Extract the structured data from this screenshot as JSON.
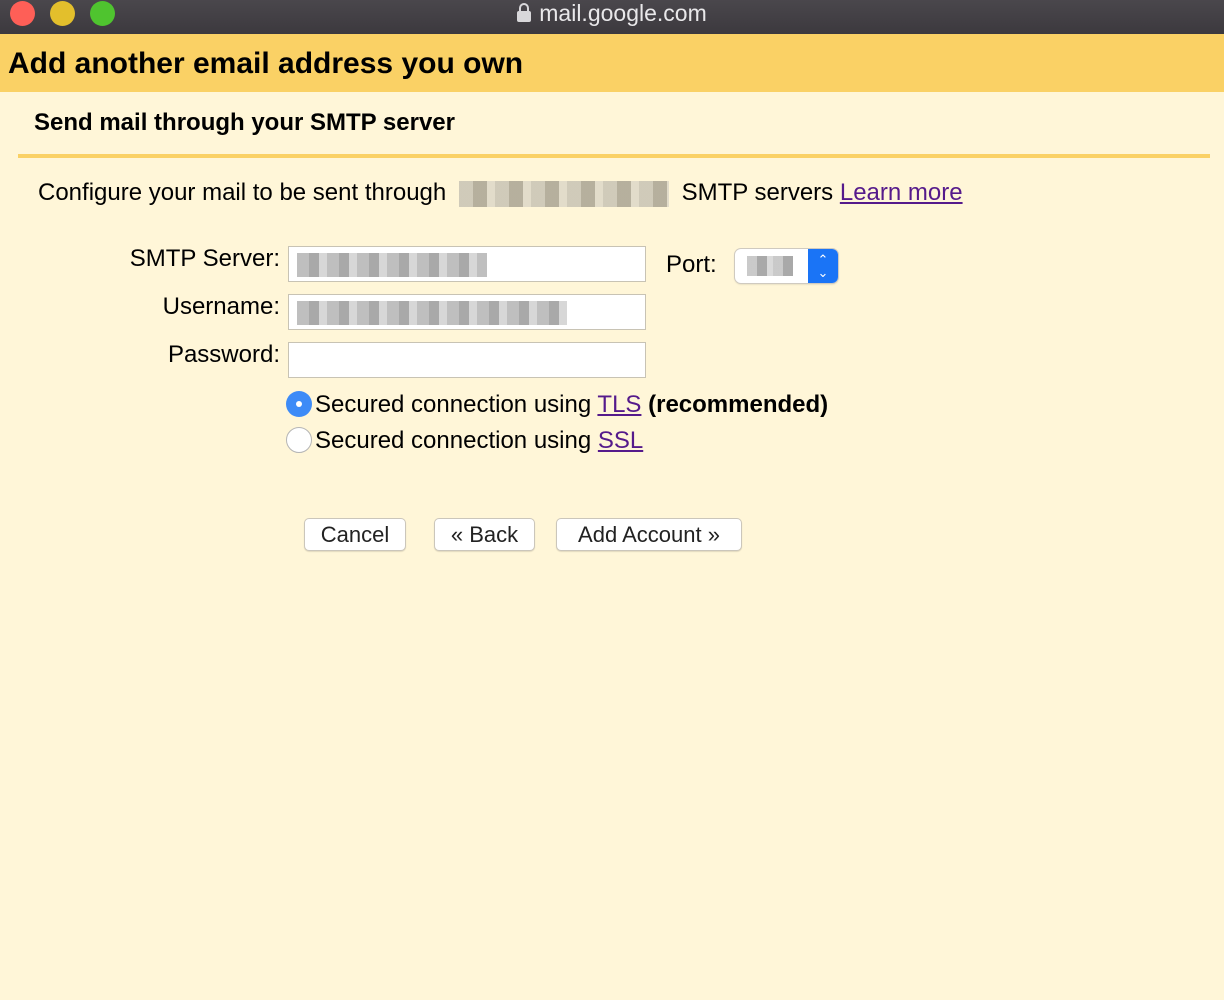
{
  "browser": {
    "url": "mail.google.com",
    "traffic_lights": [
      "close",
      "minimize",
      "maximize"
    ]
  },
  "header": {
    "title": "Add another email address you own"
  },
  "section": {
    "subtitle": "Send mail through your SMTP server"
  },
  "description": {
    "prefix": "Configure your mail to be sent through",
    "suffix": "SMTP servers",
    "learn_more": "Learn more"
  },
  "form": {
    "smtp_server_label": "SMTP Server:",
    "username_label": "Username:",
    "password_label": "Password:",
    "port_label": "Port:",
    "password_value": ""
  },
  "security": {
    "options": [
      {
        "prefix": "Secured connection using",
        "link": "TLS",
        "note": "(recommended)",
        "selected": true
      },
      {
        "prefix": "Secured connection using",
        "link": "SSL",
        "note": "",
        "selected": false
      }
    ]
  },
  "buttons": {
    "cancel": "Cancel",
    "back": "« Back",
    "add_account": "Add Account »"
  },
  "colors": {
    "header_bg": "#fad165",
    "page_bg": "#fff6d8",
    "link": "#551a8b",
    "radio_selected": "#3d8bf7"
  }
}
